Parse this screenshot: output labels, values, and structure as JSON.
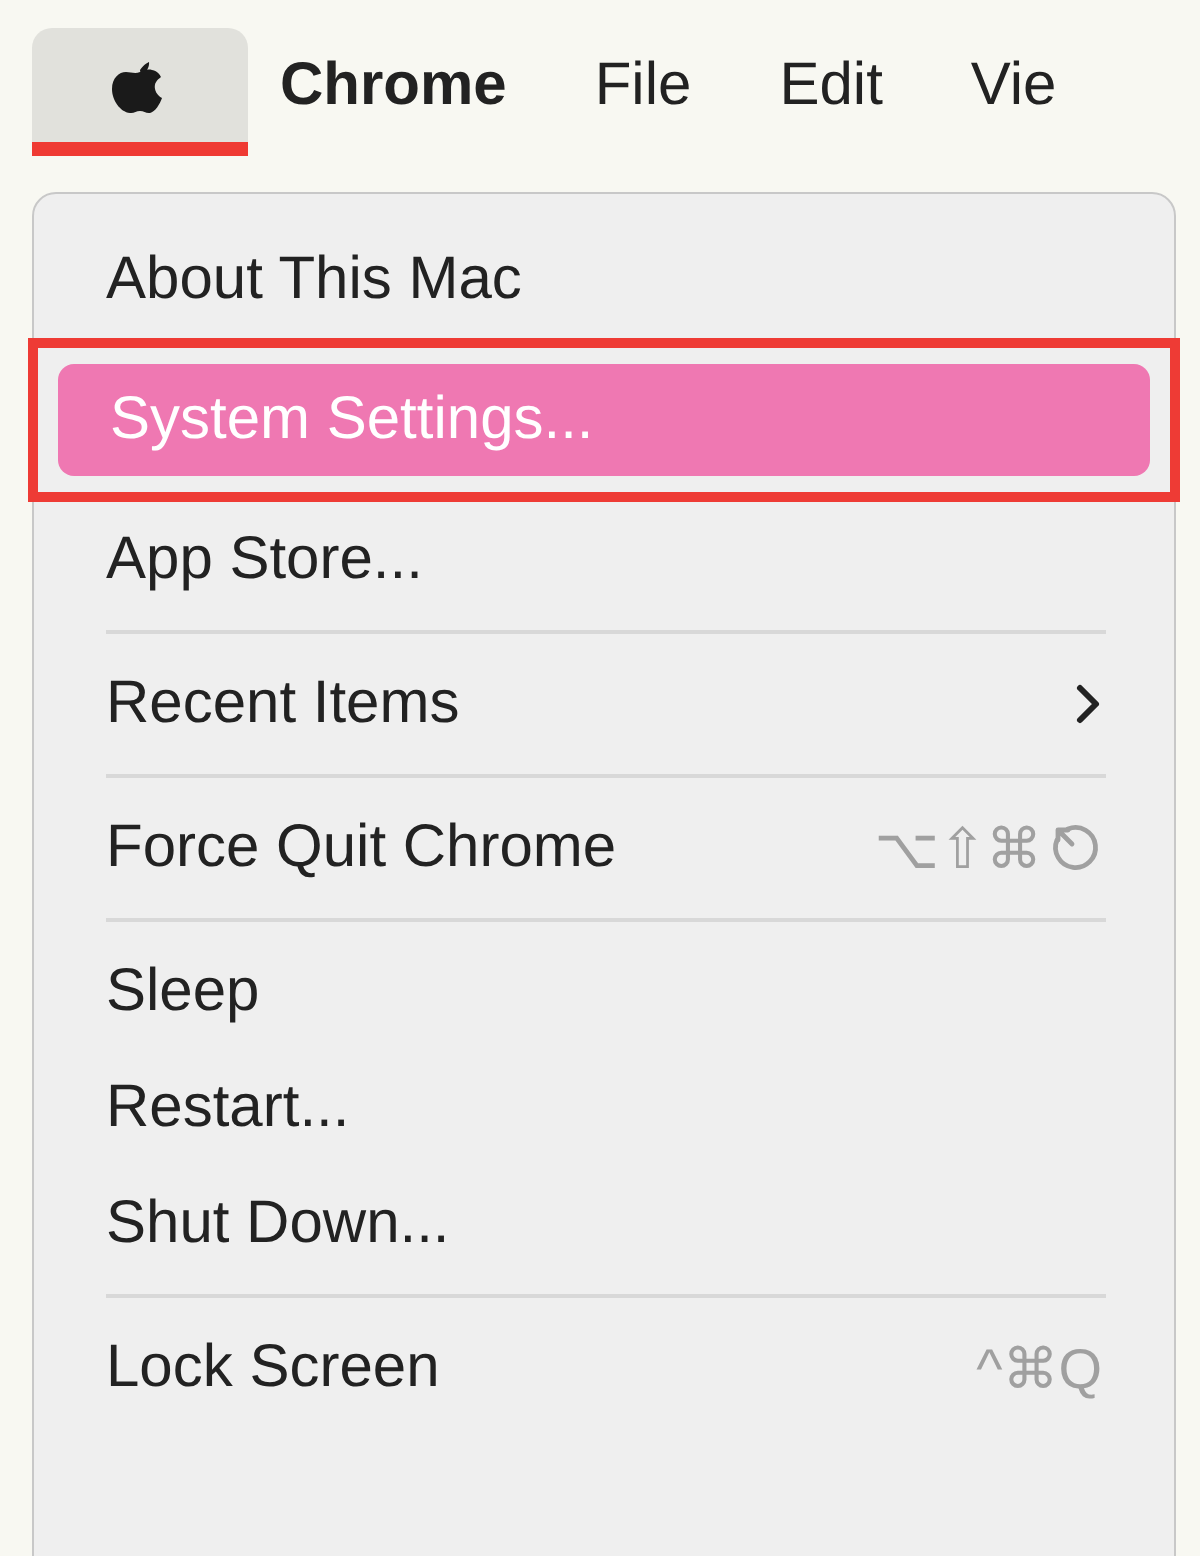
{
  "menu_bar": [
    {
      "kind": "apple",
      "selected": true
    },
    {
      "kind": "app",
      "label": "Chrome",
      "selected": false
    },
    {
      "kind": "menu",
      "label": "File",
      "selected": false
    },
    {
      "kind": "menu",
      "label": "Edit",
      "selected": false
    },
    {
      "kind": "menu",
      "label": "Vie",
      "selected": false
    }
  ],
  "menu": [
    {
      "kind": "item",
      "label": "About This Mac",
      "selected": false,
      "outlined": false
    },
    {
      "kind": "item",
      "label": "System Settings...",
      "selected": true,
      "outlined": true
    },
    {
      "kind": "item",
      "label": "App Store...",
      "selected": false,
      "outlined": false
    },
    {
      "kind": "separator"
    },
    {
      "kind": "submenu",
      "label": "Recent Items",
      "selected": false,
      "outlined": false
    },
    {
      "kind": "separator"
    },
    {
      "kind": "item",
      "label": "Force Quit Chrome",
      "shortcut": "⌥⇧⌘",
      "escape_key": true,
      "selected": false,
      "outlined": false
    },
    {
      "kind": "separator"
    },
    {
      "kind": "item",
      "label": "Sleep",
      "selected": false,
      "outlined": false
    },
    {
      "kind": "item",
      "label": "Restart...",
      "selected": false,
      "outlined": false
    },
    {
      "kind": "item",
      "label": "Shut Down...",
      "selected": false,
      "outlined": false
    },
    {
      "kind": "separator"
    },
    {
      "kind": "item",
      "label": "Lock Screen",
      "shortcut": "^⌘Q",
      "selected": false,
      "outlined": false
    }
  ]
}
